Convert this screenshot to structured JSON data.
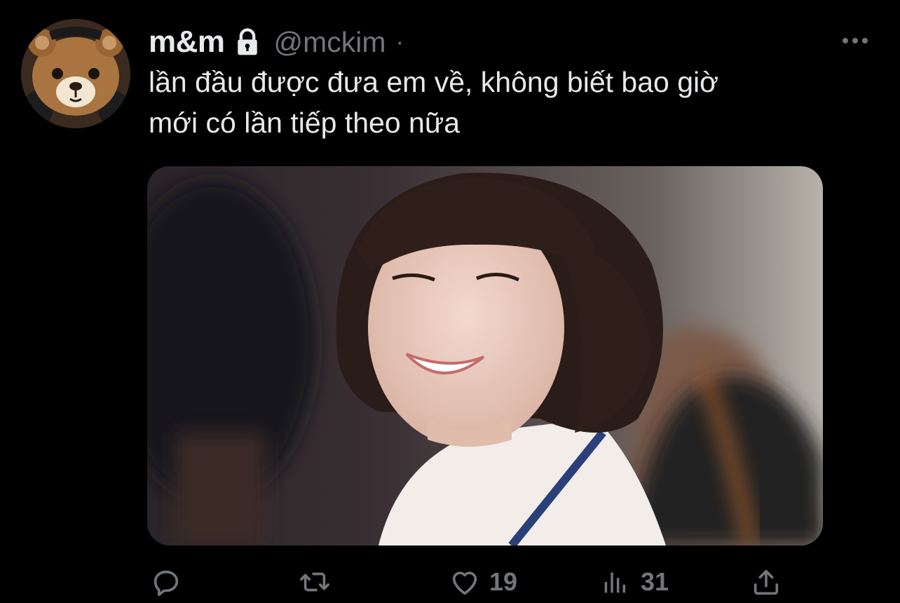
{
  "tweet": {
    "display_name": "m&m",
    "handle": "@mckim",
    "separator": "·",
    "text": "lần đầu được đưa em về, không biết bao giờ\nmới có lần tiếp theo nữa",
    "icons": {
      "verified_lock": "lock-icon",
      "more": "more-horizontal-icon"
    }
  },
  "actions": {
    "reply": {
      "icon": "reply-icon",
      "count": ""
    },
    "retweet": {
      "icon": "retweet-icon",
      "count": ""
    },
    "like": {
      "icon": "heart-icon",
      "count": "19"
    },
    "views": {
      "icon": "analytics-icon",
      "count": "31"
    },
    "share": {
      "icon": "share-icon",
      "count": ""
    }
  },
  "colors": {
    "background": "#000000",
    "text_primary": "#e7e9ea",
    "text_secondary": "#71767b"
  }
}
